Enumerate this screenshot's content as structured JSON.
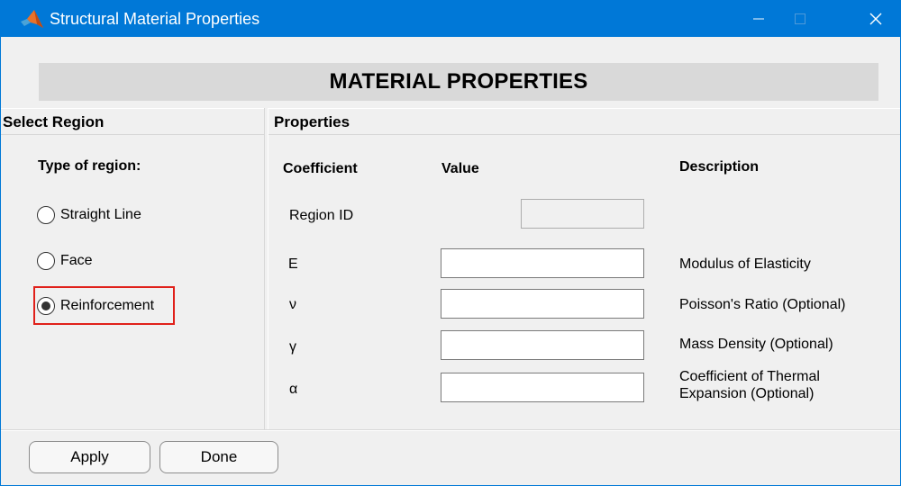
{
  "window": {
    "title": "Structural Material Properties",
    "accent_color": "#0078d7",
    "icon": "matlab-icon",
    "controls": {
      "minimize": "minimize-icon",
      "maximize": "maximize-icon",
      "close": "close-icon"
    }
  },
  "banner": {
    "title": "MATERIAL PROPERTIES"
  },
  "left_panel": {
    "header": "Select Region",
    "type_label": "Type of region:",
    "options": [
      {
        "label": "Straight Line",
        "selected": false
      },
      {
        "label": "Face",
        "selected": false
      },
      {
        "label": "Reinforcement",
        "selected": true
      }
    ],
    "highlight_color": "#e0201a"
  },
  "right_panel": {
    "header": "Properties",
    "columns": {
      "coefficient": "Coefficient",
      "value": "Value",
      "description": "Description"
    },
    "rows": [
      {
        "coefficient": "Region ID",
        "value": "",
        "description": "",
        "disabled": true
      },
      {
        "coefficient": "E",
        "value": "",
        "description": "Modulus of Elasticity"
      },
      {
        "coefficient": "ν",
        "value": "",
        "description": "Poisson's Ratio (Optional)"
      },
      {
        "coefficient": "γ",
        "value": "",
        "description": "Mass Density (Optional)"
      },
      {
        "coefficient": "α",
        "value": "",
        "description_line1": "Coefficient of Thermal",
        "description_line2": "Expansion (Optional)"
      }
    ]
  },
  "footer": {
    "apply_label": "Apply",
    "done_label": "Done"
  }
}
